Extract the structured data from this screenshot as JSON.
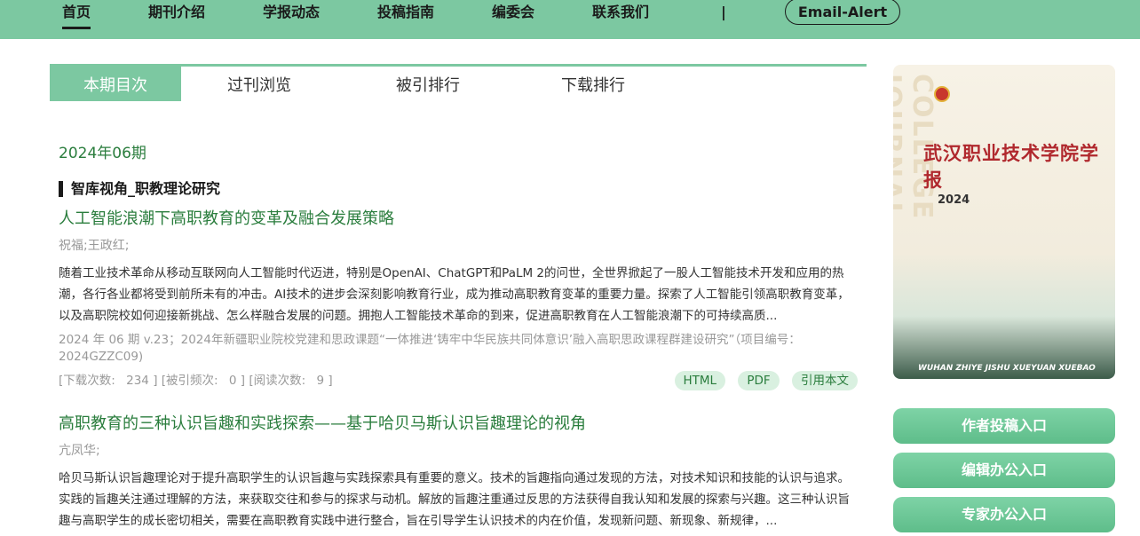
{
  "nav": {
    "items": [
      "首页",
      "期刊介绍",
      "学报动态",
      "投稿指南",
      "编委会",
      "联系我们"
    ],
    "separator": "|",
    "email_alert": "Email-Alert"
  },
  "tabs": [
    "本期目次",
    "过刊浏览",
    "被引排行",
    "下载排行"
  ],
  "issue": {
    "title": "2024年06期"
  },
  "section": {
    "title": "智库视角_职教理论研究"
  },
  "articles": [
    {
      "title": "人工智能浪潮下高职教育的变革及融合发展策略",
      "authors": "祝福;王政红;",
      "abstract": "随着工业技术革命从移动互联网向人工智能时代迈进，特别是OpenAI、ChatGPT和PaLM 2的问世，全世界掀起了一股人工智能技术开发和应用的热潮，各行各业都将受到前所未有的冲击。AI技术的进步会深刻影响教育行业，成为推动高职教育变革的重要力量。探索了人工智能引领高职教育变革，以及高职院校如何迎接新挑战、怎么样融合发展的问题。拥抱人工智能技术革命的到来，促进高职教育在人工智能浪潮下的可持续高质...",
      "meta": "2024 年 06 期 v.23；2024年新疆职业院校党建和思政课题“一体推进‘铸牢中华民族共同体意识’融入高职思政课程群建设研究”（项目编号：2024GZZC09)",
      "downloads_label": "[下载次数:",
      "downloads": "234",
      "citations_label": "] [被引频次:",
      "citations": "0",
      "reads_label": "] [阅读次数:",
      "reads": "9",
      "end_bracket": "]",
      "buttons": [
        "HTML",
        "PDF",
        "引用本文"
      ]
    },
    {
      "title": "高职教育的三种认识旨趣和实践探索——基于哈贝马斯认识旨趣理论的视角",
      "authors": "亢凤华;",
      "abstract": "哈贝马斯认识旨趣理论对于提升高职学生的认识旨趣与实践探索具有重要的意义。技术的旨趣指向通过发现的方法，对技术知识和技能的认识与追求。实践的旨趣关注通过理解的方法，来获取交往和参与的探求与动机。解放的旨趣注重通过反思的方法获得自我认知和发展的探索与兴趣。这三种认识旨趣与高职学生的成长密切相关，需要在高职教育实践中进行整合，旨在引导学生认识技术的内在价值，发现新问题、新现象、新规律，..."
    }
  ],
  "cover": {
    "vertical_text": "COLLEGE JOURNAL",
    "title": "武汉职业技术学院学报",
    "year": "2024",
    "bottom_text": "WUHAN ZHIYE JISHU XUEYUAN XUEBAO"
  },
  "side_buttons": [
    "作者投稿入口",
    "编辑办公入口",
    "专家办公入口"
  ]
}
